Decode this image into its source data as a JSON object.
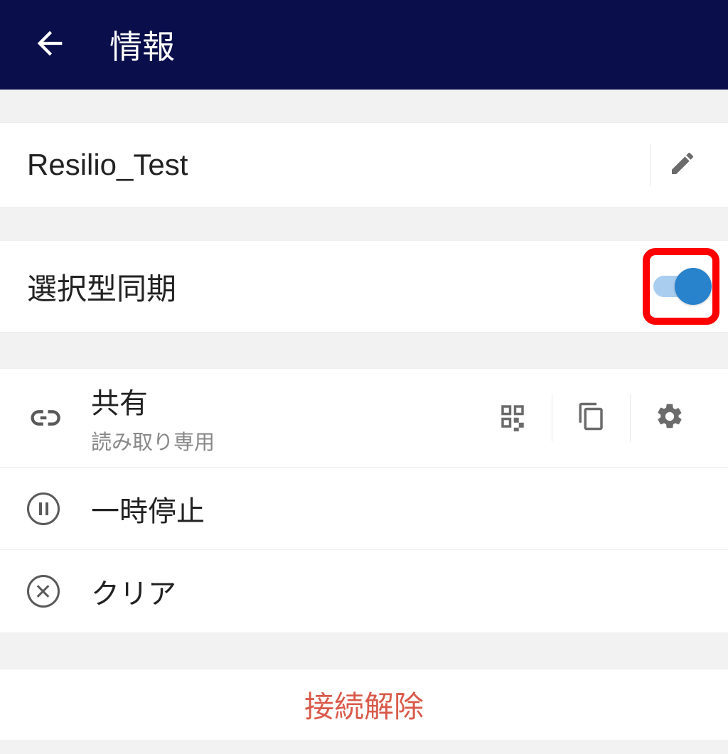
{
  "header": {
    "title": "情報"
  },
  "folder": {
    "name": "Resilio_Test"
  },
  "selective_sync": {
    "label": "選択型同期",
    "enabled": true
  },
  "actions": {
    "share": {
      "title": "共有",
      "subtitle": "読み取り専用"
    },
    "pause": {
      "title": "一時停止"
    },
    "clear": {
      "title": "クリア"
    }
  },
  "disconnect": {
    "label": "接続解除"
  },
  "icons": {
    "back": "back-arrow",
    "edit": "pencil",
    "link": "link",
    "qr": "qr-code",
    "copy": "copy",
    "settings": "gear",
    "pause": "pause",
    "clear": "close"
  },
  "colors": {
    "header_bg": "#0a0e4a",
    "highlight": "#ff0000",
    "toggle_on": "#2982cc",
    "disconnect": "#d95a4a"
  }
}
